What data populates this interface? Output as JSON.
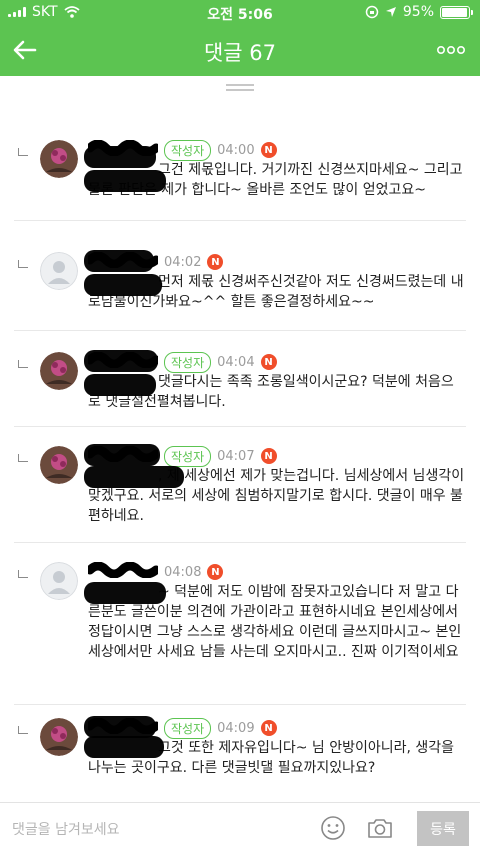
{
  "status_bar": {
    "carrier": "SKT",
    "time": "오전 5:06",
    "battery": "95%",
    "battery_level": 0.95
  },
  "app_bar": {
    "title": "댓글 67",
    "back_icon": "arrow-left-icon",
    "more_icon": "more-dots-icon"
  },
  "comments": [
    {
      "author_badge": "작성자",
      "time": "04:00",
      "new_mark": "N",
      "text": "그건 제몫입니다. 거기까진 신경쓰지마세요~ 그리고 물론 판단은 제가 합니다~ 올바른 조언도 많이 얻었고요~",
      "avatar": "profile-photo"
    },
    {
      "author_badge": "",
      "time": "04:02",
      "new_mark": "N",
      "text": "먼저 제몫 신경써주신것같아 저도 신경써드렸는데 내로남불이신가봐요~^^ 할튼 좋은결정하세요~~",
      "avatar": "default-user"
    },
    {
      "author_badge": "작성자",
      "time": "04:04",
      "new_mark": "N",
      "text": "댓글다시는 족족 조롱일색이시군요? 덕분에 처음으로 댓글설전펼쳐봅니다.",
      "avatar": "profile-photo"
    },
    {
      "author_badge": "작성자",
      "time": "04:07",
      "new_mark": "N",
      "text": ", 제 세상에선 제가 맞는겁니다. 님세상에서 님생각이 맞겠구요. 서로의 세상에 침범하지말기로 합시다. 댓글이 매우 불편하네요.",
      "avatar": "profile-photo"
    },
    {
      "author_badge": "",
      "time": "04:08",
      "new_mark": "N",
      "text": "~ 덕분에 저도 이밤에 잠못자고있습니다 저 말고 다른분도 글쓴이분 의견에 가관이라고 표현하시네요 본인세상에서 정답이시면 그냥 스스로 생각하세요 이런데 글쓰지마시고~ 본인세상에서만 사세요 남들 사는데 오지마시고.. 진짜 이기적이세요",
      "avatar": "default-user"
    },
    {
      "author_badge": "작성자",
      "time": "04:09",
      "new_mark": "N",
      "text": "그것 또한 제자유입니다~ 님 안방이아니라, 생각을 나누는 곳이구요. 다른 댓글빗댈 필요까지있나요?",
      "avatar": "profile-photo"
    }
  ],
  "input_bar": {
    "placeholder": "댓글을 남겨보세요",
    "submit_label": "등록",
    "emoji_icon": "emoji-icon",
    "camera_icon": "camera-icon"
  },
  "colors": {
    "brand_green": "#5cc451",
    "new_badge_red": "#f04e2b",
    "submit_gray": "#c3c3c3"
  }
}
